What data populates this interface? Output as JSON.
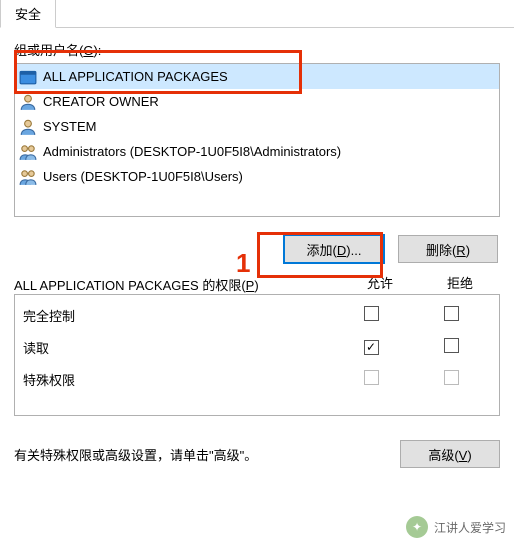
{
  "tab": {
    "label": "安全"
  },
  "groups": {
    "label_prefix": "组或用户名(",
    "label_mnemonic": "G",
    "label_suffix": "):",
    "items": [
      {
        "label": "ALL APPLICATION PACKAGES",
        "icon": "package",
        "selected": true
      },
      {
        "label": "CREATOR OWNER",
        "icon": "user",
        "selected": false
      },
      {
        "label": "SYSTEM",
        "icon": "user",
        "selected": false
      },
      {
        "label": "Administrators (DESKTOP-1U0F5I8\\Administrators)",
        "icon": "group",
        "selected": false
      },
      {
        "label": "Users (DESKTOP-1U0F5I8\\Users)",
        "icon": "group",
        "selected": false
      }
    ]
  },
  "buttons": {
    "add_prefix": "添加(",
    "add_mnemonic": "D",
    "add_suffix": ")...",
    "remove_prefix": "删除(",
    "remove_mnemonic": "R",
    "remove_suffix": ")"
  },
  "permissions": {
    "title_prefix": "ALL APPLICATION PACKAGES 的权限(",
    "title_mnemonic": "P",
    "title_suffix": ")",
    "col_allow": "允许",
    "col_deny": "拒绝",
    "rows": [
      {
        "name": "完全控制",
        "allow": false,
        "deny": false,
        "enabled": true
      },
      {
        "name": "读取",
        "allow": true,
        "deny": false,
        "enabled": true
      },
      {
        "name": "特殊权限",
        "allow": false,
        "deny": false,
        "enabled": false
      }
    ]
  },
  "footer": {
    "text": "有关特殊权限或高级设置，请单击\"高级\"。",
    "adv_prefix": "高级(",
    "adv_mnemonic": "V",
    "adv_suffix": ")"
  },
  "callouts": {
    "num1": "1"
  },
  "watermark": {
    "text": "江讲人爱学习"
  }
}
